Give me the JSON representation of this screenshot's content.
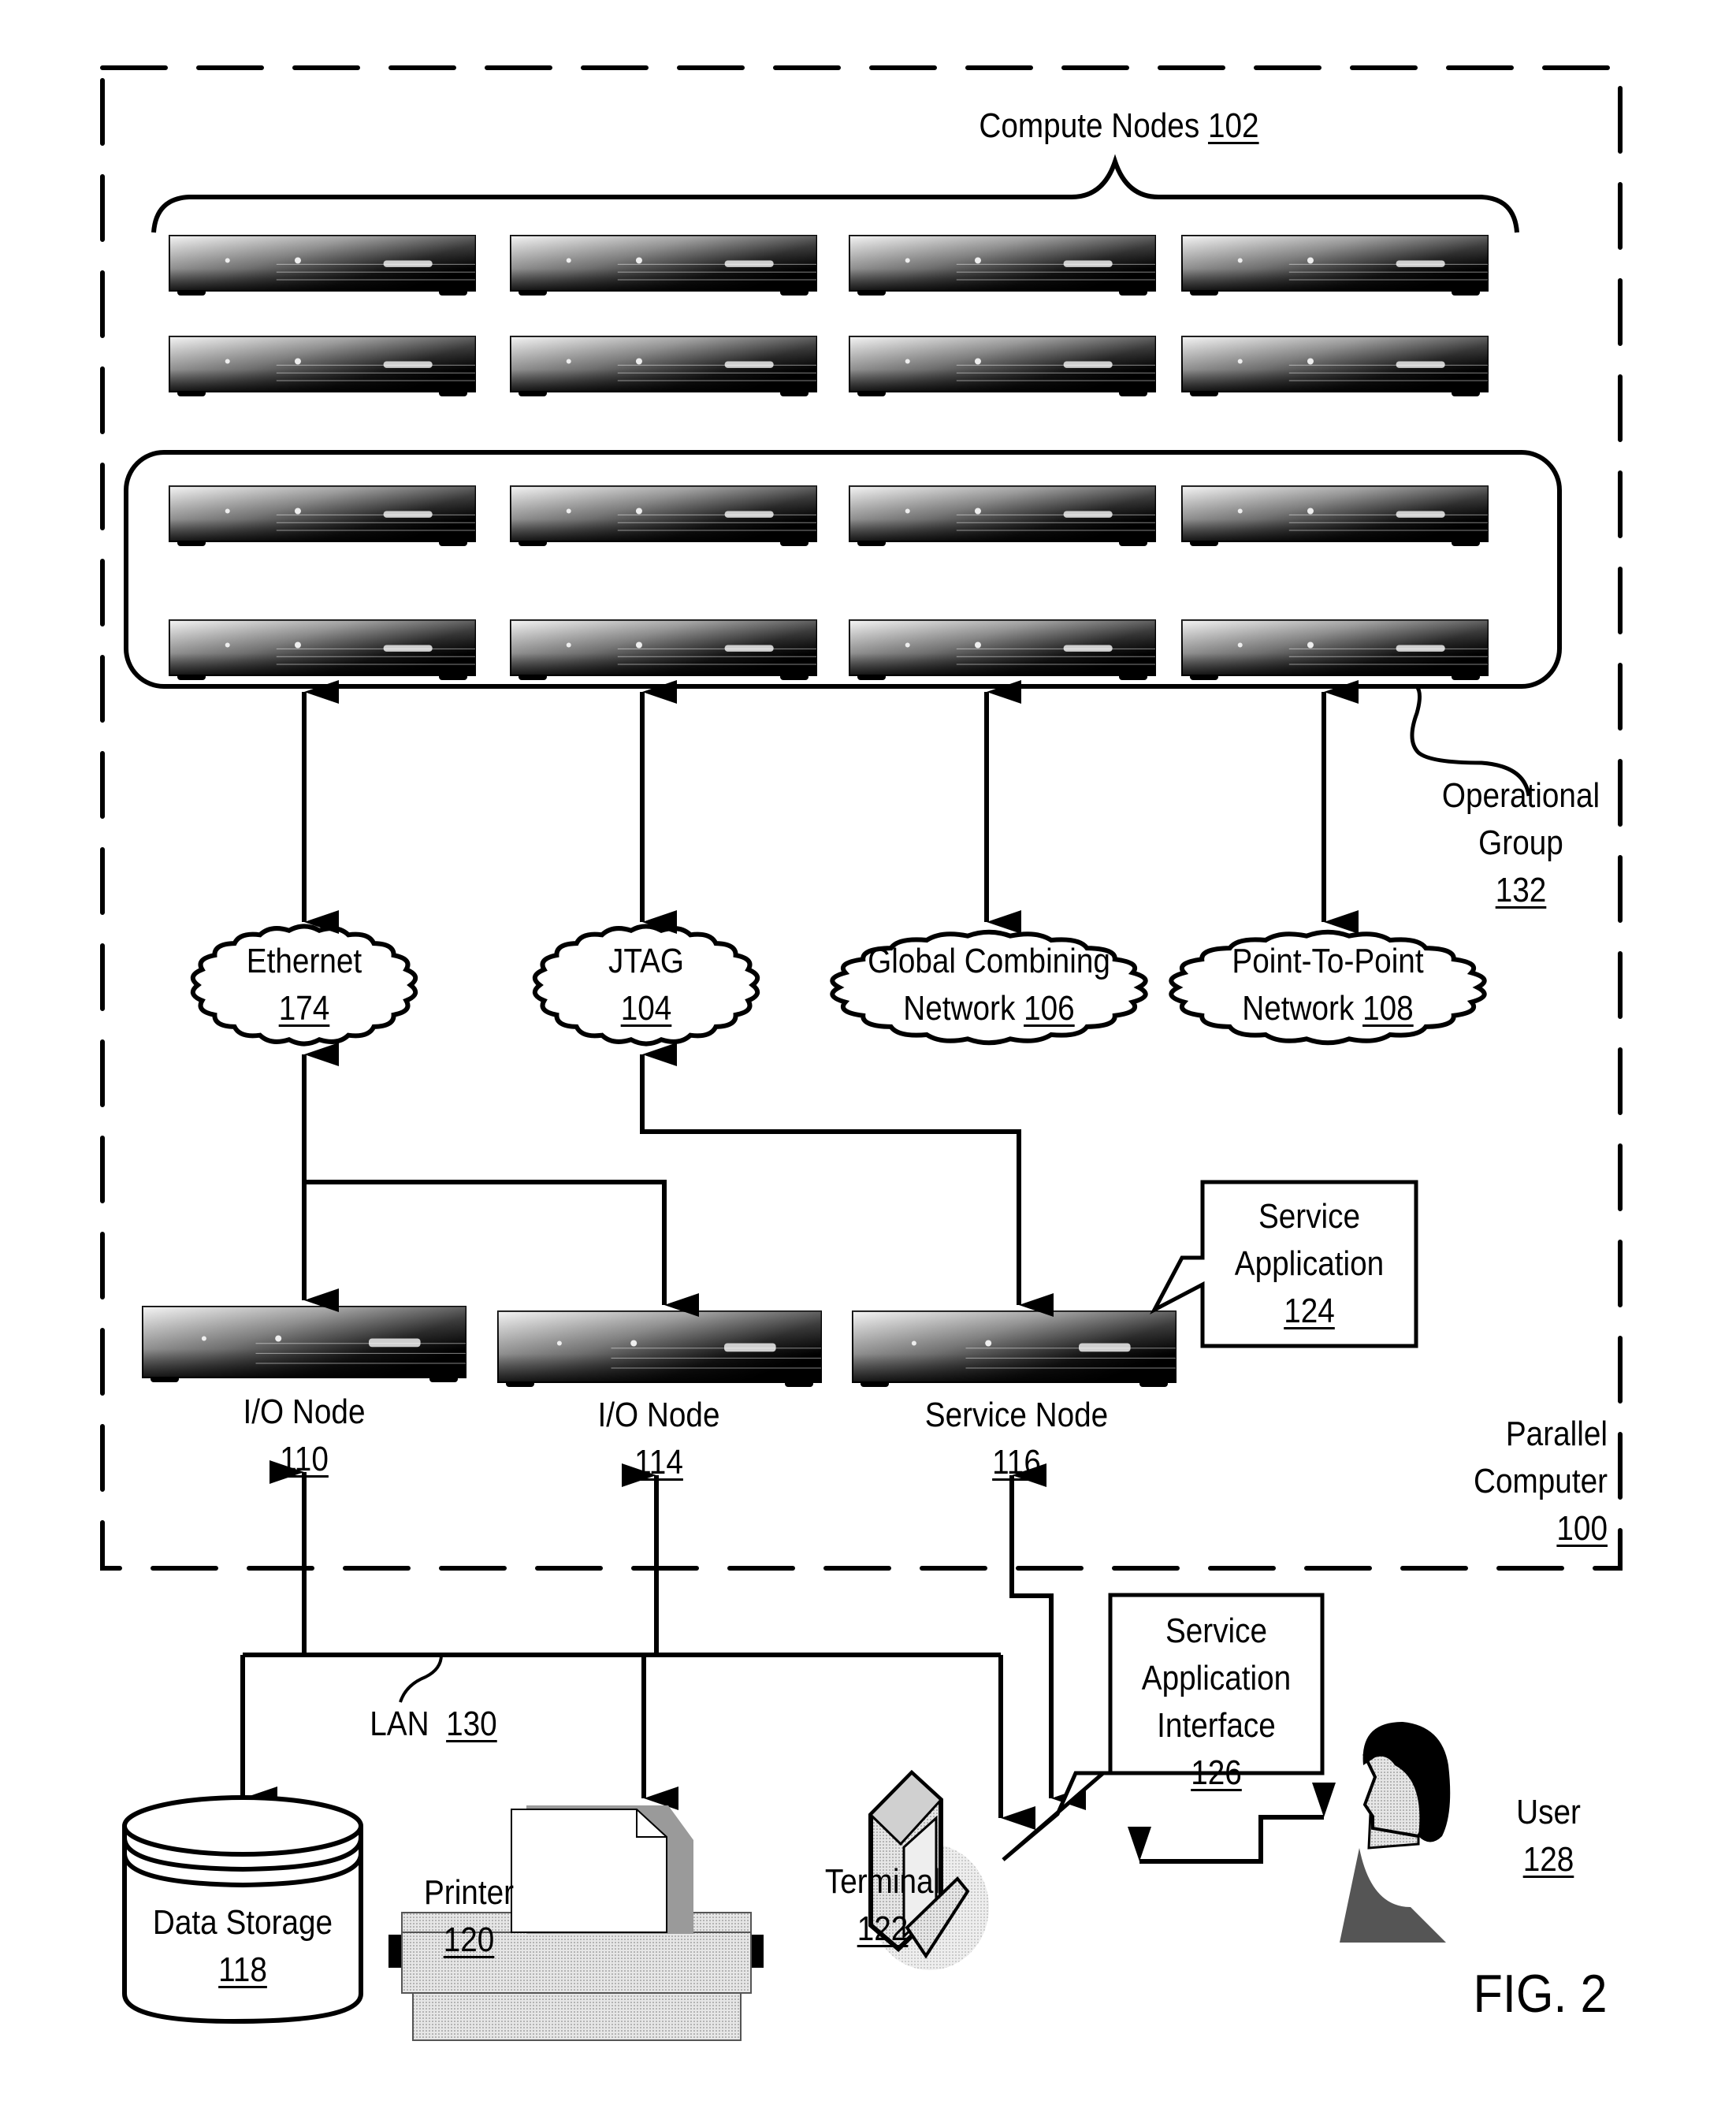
{
  "figure": {
    "label": "FIG. 2"
  },
  "parallel_computer": {
    "name_line1": "Parallel",
    "name_line2": "Computer",
    "ref": "100"
  },
  "compute_nodes": {
    "name": "Compute Nodes",
    "ref": "102",
    "rows": 4,
    "columns": 4
  },
  "operational_group": {
    "name_line1": "Operational",
    "name_line2": "Group",
    "ref": "132",
    "rows_included": 2
  },
  "networks": [
    {
      "id": "ethernet",
      "line1": "Ethernet",
      "line2": "",
      "ref": "174"
    },
    {
      "id": "jtag",
      "line1": "JTAG",
      "line2": "",
      "ref": "104"
    },
    {
      "id": "global-combining",
      "line1": "Global Combining",
      "line2": "Network",
      "ref": "106"
    },
    {
      "id": "point-to-point",
      "line1": "Point-To-Point",
      "line2": "Network",
      "ref": "108"
    }
  ],
  "io_nodes": [
    {
      "name": "I/O Node",
      "ref": "110"
    },
    {
      "name": "I/O Node",
      "ref": "114"
    }
  ],
  "service_node": {
    "name": "Service Node",
    "ref": "116"
  },
  "service_application": {
    "line1": "Service",
    "line2": "Application",
    "ref": "124"
  },
  "lan": {
    "name": "LAN",
    "ref": "130"
  },
  "data_storage": {
    "name": "Data Storage",
    "ref": "118"
  },
  "printer": {
    "name": "Printer",
    "ref": "120"
  },
  "terminal": {
    "name": "Terminal",
    "ref": "122"
  },
  "service_application_interface": {
    "line1": "Service",
    "line2": "Application",
    "line3": "Interface",
    "ref": "126"
  },
  "user": {
    "name": "User",
    "ref": "128"
  },
  "colors": {
    "line": "#000000",
    "background": "#ffffff"
  }
}
